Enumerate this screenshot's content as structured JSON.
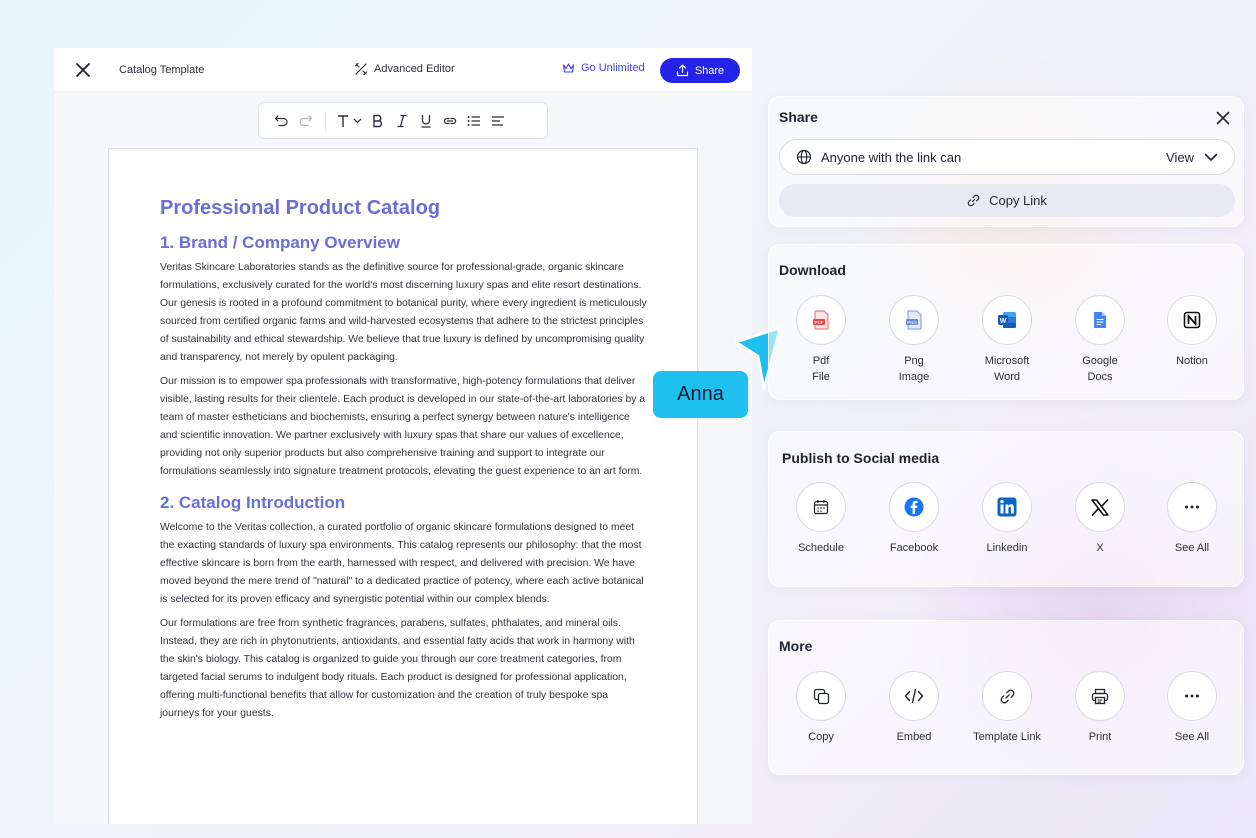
{
  "editor": {
    "doc_title": "Catalog Template",
    "advanced_editor": "Advanced Editor",
    "go_unlimited": "Go Unlimited",
    "share": "Share"
  },
  "document": {
    "title": "Professional Product Catalog",
    "section1": {
      "heading": "1. Brand / Company Overview",
      "p1": "Veritas Skincare Laboratories stands as the definitive source for professional-grade, organic skincare formulations, exclusively curated for the world's most discerning luxury spas and elite resort destinations. Our genesis is rooted in a profound commitment to botanical purity, where every ingredient is meticulously sourced from certified organic farms and wild-harvested ecosystems that adhere to the strictest principles of sustainability and ethical stewardship. We believe that true luxury is defined by uncompromising quality and transparency, not merely by opulent packaging.",
      "p2": "Our mission is to empower spa professionals with transformative, high-potency formulations that deliver visible, lasting results for their clientele. Each product is developed in our state-of-the-art laboratories by a team of master estheticians and biochemists, ensuring a perfect synergy between nature's intelligence and scientific innovation. We partner exclusively with luxury spas that share our values of excellence, providing not only superior products but also comprehensive training and support to integrate our formulations seamlessly into signature treatment protocols, elevating the guest experience to an art form."
    },
    "section2": {
      "heading": "2. Catalog Introduction",
      "p1": "Welcome to the Veritas collection, a curated portfolio of organic skincare formulations designed to meet the exacting standards of luxury spa environments. This catalog represents our philosophy: that the most effective skincare is born from the earth, harnessed with respect, and delivered with precision. We have moved beyond the mere trend of \"natural\" to a dedicated practice of potency, where each active botanical is selected for its proven efficacy and synergistic potential within our complex blends.",
      "p2": "Our formulations are free from synthetic fragrances, parabens, sulfates, phthalates, and mineral oils. Instead, they are rich in phytonutrients, antioxidants, and essential fatty acids that work in harmony with the skin's biology. This catalog is organized to guide you through our core treatment categories, from targeted facial serums to indulgent body rituals. Each product is designed for professional application, offering multi-functional benefits that allow for customization and the creation of truly bespoke spa journeys for your guests."
    }
  },
  "collaborator": {
    "name": "Anna",
    "color": "#1ec0f0"
  },
  "share_panel": {
    "title": "Share",
    "access": "Anyone with the link can",
    "permission": "View",
    "copy_link": "Copy Link"
  },
  "download_panel": {
    "title": "Download",
    "items": [
      {
        "line1": "Pdf",
        "line2": "File",
        "icon": "pdf-icon"
      },
      {
        "line1": "Png",
        "line2": "Image",
        "icon": "png-icon"
      },
      {
        "line1": "Microsoft",
        "line2": "Word",
        "icon": "word-icon"
      },
      {
        "line1": "Google",
        "line2": "Docs",
        "icon": "google-docs-icon"
      },
      {
        "line1": "Notion",
        "line2": "",
        "icon": "notion-icon"
      }
    ]
  },
  "social_panel": {
    "title": "Publish to Social media",
    "items": [
      {
        "label": "Schedule",
        "icon": "calendar-icon"
      },
      {
        "label": "Facebook",
        "icon": "facebook-icon"
      },
      {
        "label": "Linkedin",
        "icon": "linkedin-icon"
      },
      {
        "label": "X",
        "icon": "x-icon"
      },
      {
        "label": "See All",
        "icon": "more-icon"
      }
    ]
  },
  "more_panel": {
    "title": "More",
    "items": [
      {
        "label": "Copy",
        "icon": "copy-icon"
      },
      {
        "label": "Embed",
        "icon": "embed-icon"
      },
      {
        "label": "Template Link",
        "icon": "link-icon"
      },
      {
        "label": "Print",
        "icon": "printer-icon"
      },
      {
        "label": "See All",
        "icon": "more-icon"
      }
    ]
  },
  "colors": {
    "accent": "#2424e8",
    "heading": "#6a6fd8"
  }
}
